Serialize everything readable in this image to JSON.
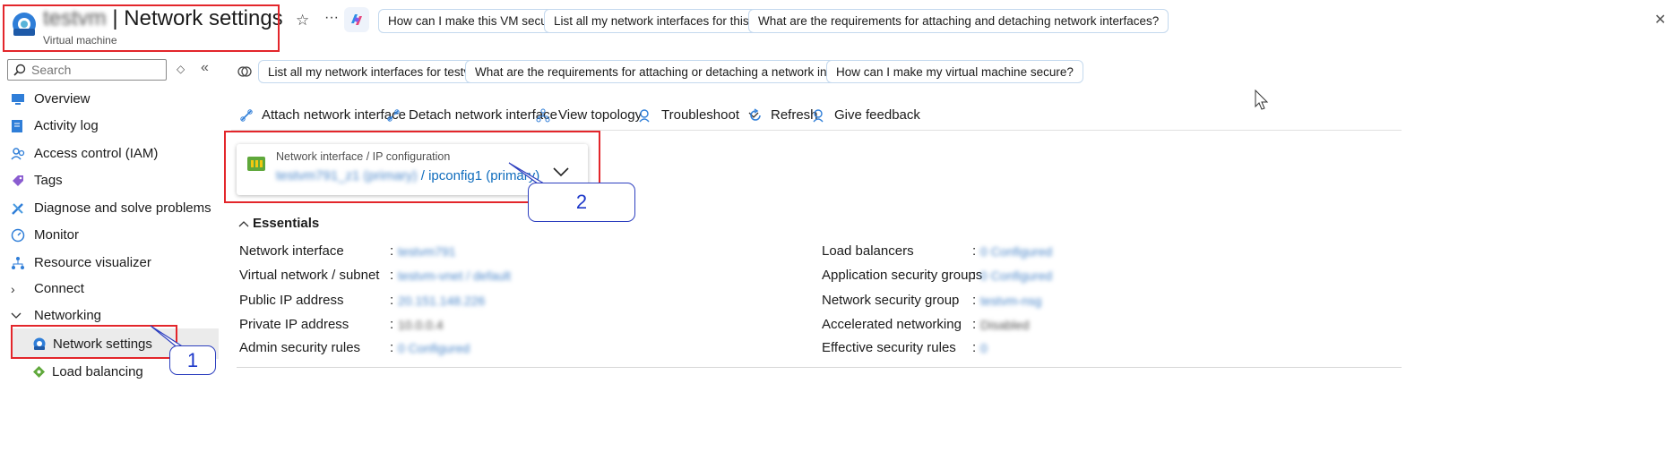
{
  "header": {
    "resource_name": "testvm",
    "title_separator": "|",
    "page_title": "Network settings",
    "resource_type": "Virtual machine"
  },
  "top_suggestions": [
    "How can I make this VM secure?",
    "List all my network interfaces for this VM",
    "What are the requirements for attaching and detaching network interfaces?"
  ],
  "copilot_suggestions": [
    "List all my network interfaces for testvm.",
    "What are the requirements for attaching or detaching a network interface?",
    "How can I make my virtual machine secure?"
  ],
  "search": {
    "placeholder": "Search"
  },
  "sidebar": {
    "items": [
      {
        "label": "Overview",
        "icon": "monitor-icon"
      },
      {
        "label": "Activity log",
        "icon": "log-icon"
      },
      {
        "label": "Access control (IAM)",
        "icon": "people-icon"
      },
      {
        "label": "Tags",
        "icon": "tag-icon"
      },
      {
        "label": "Diagnose and solve problems",
        "icon": "wrench-icon"
      },
      {
        "label": "Monitor",
        "icon": "gauge-icon"
      },
      {
        "label": "Resource visualizer",
        "icon": "hierarchy-icon"
      },
      {
        "label": "Connect",
        "icon": "chevron-right-icon"
      },
      {
        "label": "Networking",
        "icon": "chevron-down-icon"
      },
      {
        "label": "Network settings",
        "icon": "network-settings-icon",
        "selected": true
      },
      {
        "label": "Load balancing",
        "icon": "load-balancer-icon"
      }
    ]
  },
  "toolbar": {
    "attach": "Attach network interface",
    "detach": "Detach network interface",
    "topology": "View topology",
    "troubleshoot": "Troubleshoot",
    "refresh": "Refresh",
    "feedback": "Give feedback"
  },
  "nic_card": {
    "label": "Network interface / IP configuration",
    "nic_name": "testvm791_z1 (primary)",
    "separator": "/",
    "ipconfig": "ipconfig1 (primary)"
  },
  "essentials": {
    "title": "Essentials",
    "left": [
      {
        "label": "Network interface",
        "value": "testvm791"
      },
      {
        "label": "Virtual network / subnet",
        "value": "testvm-vnet / default"
      },
      {
        "label": "Public IP address",
        "value": "20.151.148.226"
      },
      {
        "label": "Private IP address",
        "value": "10.0.0.4"
      },
      {
        "label": "Admin security rules",
        "value": "0 Configured"
      }
    ],
    "right": [
      {
        "label": "Load balancers",
        "value": "0 Configured"
      },
      {
        "label": "Application security groups",
        "value": "0 Configured"
      },
      {
        "label": "Network security group",
        "value": "testvm-nsg"
      },
      {
        "label": "Accelerated networking",
        "value": "Disabled"
      },
      {
        "label": "Effective security rules",
        "value": "0"
      }
    ]
  },
  "callouts": {
    "first": "1",
    "second": "2"
  },
  "colors": {
    "accent": "#0f6cbd",
    "annotation_red": "#e3262b",
    "callout_blue": "#1d38c9"
  }
}
